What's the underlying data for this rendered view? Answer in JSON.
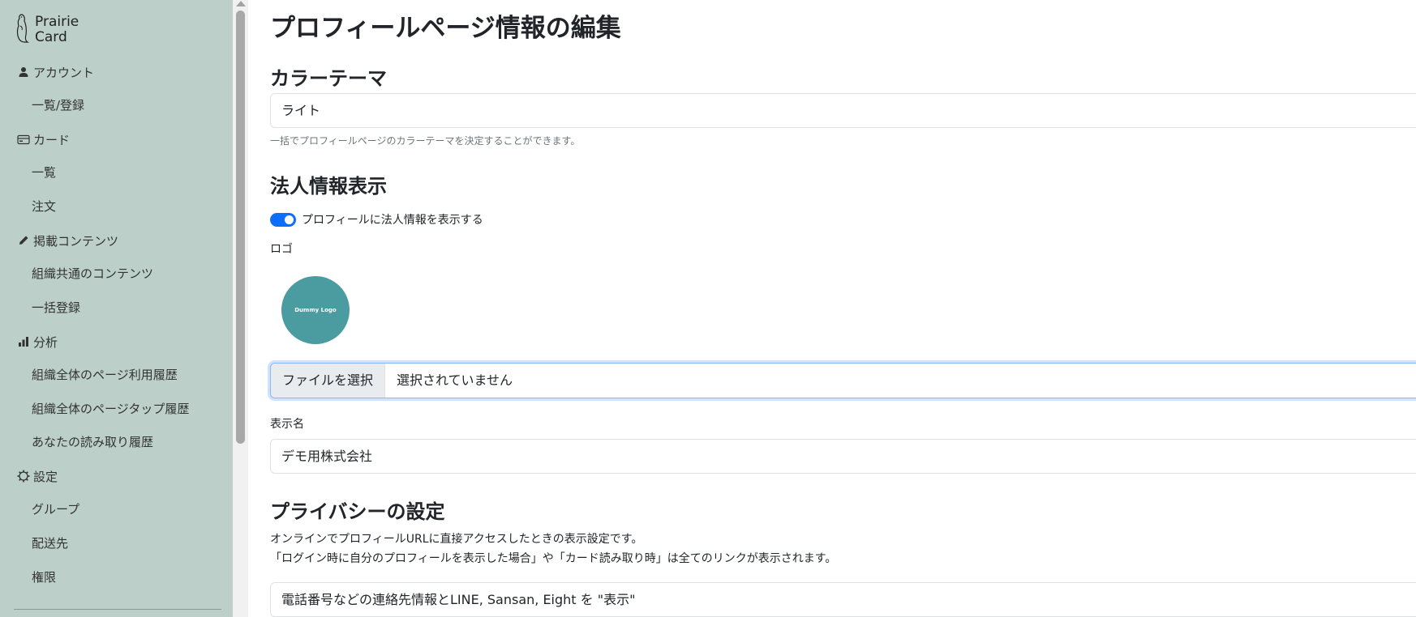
{
  "sidebar": {
    "brand": {
      "line1": "Prairie",
      "line2": "Card"
    },
    "sections": [
      {
        "icon": "person-icon",
        "label": "アカウント",
        "items": [
          "一覧/登録"
        ]
      },
      {
        "icon": "card-icon",
        "label": "カード",
        "items": [
          "一覧",
          "注文"
        ]
      },
      {
        "icon": "pencil-icon",
        "label": "掲載コンテンツ",
        "items": [
          "組織共通のコンテンツ",
          "一括登録"
        ]
      },
      {
        "icon": "bar-chart-icon",
        "label": "分析",
        "items": [
          "組織全体のページ利用履歴",
          "組織全体のページタップ履歴",
          "あなたの読み取り履歴"
        ]
      },
      {
        "icon": "gear-icon",
        "label": "設定",
        "items": [
          "グループ",
          "配送先",
          "権限"
        ]
      }
    ]
  },
  "main": {
    "page_title": "プロフィールページ情報の編集",
    "color_theme": {
      "heading": "カラーテーマ",
      "value": "ライト",
      "help": "一括でプロフィールページのカラーテーマを決定することができます。"
    },
    "corporate": {
      "heading": "法人情報表示",
      "toggle_label": "プロフィールに法人情報を表示する",
      "toggle_on": true,
      "logo_label": "ロゴ",
      "logo_text": "Dummy Logo",
      "file_button": "ファイルを選択",
      "file_status": "選択されていません",
      "display_name_label": "表示名",
      "display_name_value": "デモ用株式会社"
    },
    "privacy": {
      "heading": "プライバシーの設定",
      "desc_line1": "オンラインでプロフィールURLに直接アクセスしたときの表示設定です。",
      "desc_line2": "「ログイン時に自分のプロフィールを表示した場合」や「カード読み取り時」は全てのリンクが表示されます。",
      "select_value": "電話番号などの連絡先情報とLINE, Sansan, Eight を \"表示\""
    }
  },
  "colors": {
    "sidebar_bg": "#bccfc9",
    "accent": "#0d6efd",
    "logo_bg": "#4b9ca0"
  }
}
